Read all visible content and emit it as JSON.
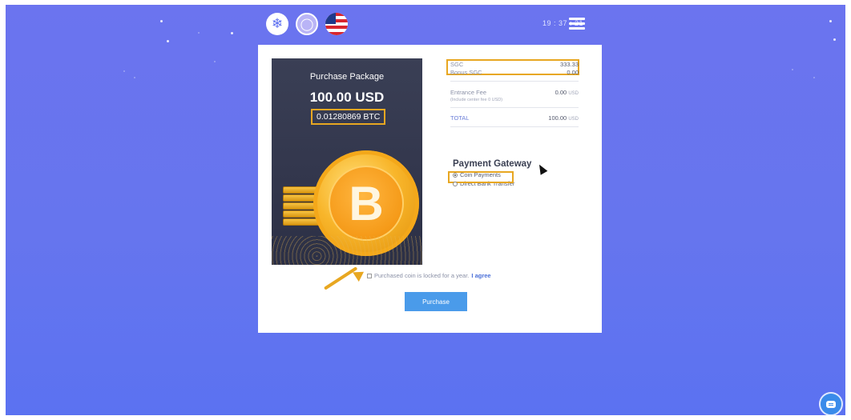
{
  "header": {
    "clock": "19 : 37 : 21",
    "icons": [
      "snowflake-icon",
      "user-icon",
      "us-flag-icon",
      "menu-icon"
    ]
  },
  "package": {
    "title": "Purchase Package",
    "usd": "100.00 USD",
    "btc": "0.01280869 BTC"
  },
  "summary": {
    "sgc_label": "SGC",
    "sgc_value": "333.33",
    "bonus_label": "Bonus SGC",
    "bonus_value": "0.00",
    "fee_label": "Entrance Fee",
    "fee_note": "(Include center fee 0 USD)",
    "fee_value": "0.00",
    "fee_unit": "USD",
    "total_label": "TOTAL",
    "total_value": "100.00",
    "total_unit": "USD"
  },
  "gateway": {
    "title": "Payment Gateway",
    "options": [
      {
        "label": "Coin Payments",
        "selected": true
      },
      {
        "label": "Direct Bank Transfer",
        "selected": false
      }
    ]
  },
  "agreement": {
    "text": "Purchased coin is locked for a year.",
    "link": "I agree"
  },
  "actions": {
    "purchase_label": "Purchase"
  },
  "colors": {
    "background": "#6675ee",
    "highlight": "#e8a721",
    "button": "#4a9bea"
  }
}
